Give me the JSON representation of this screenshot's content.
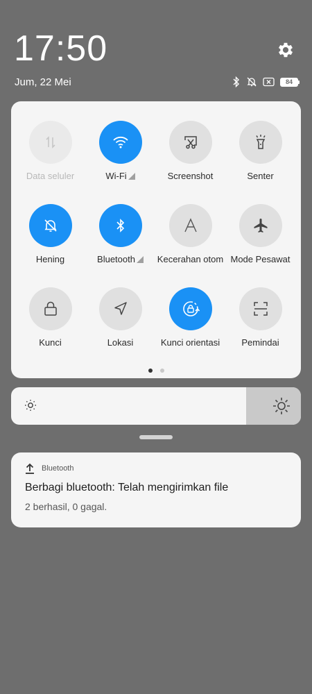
{
  "status": {
    "time": "17:50",
    "date": "Jum, 22 Mei",
    "battery": "84"
  },
  "quick_settings": {
    "tiles": [
      {
        "label": "Data seluler",
        "icon": "mobile-data-icon",
        "state": "disabled"
      },
      {
        "label": "Wi-Fi",
        "icon": "wifi-icon",
        "state": "on"
      },
      {
        "label": "Screenshot",
        "icon": "screenshot-icon",
        "state": "off"
      },
      {
        "label": "Senter",
        "icon": "flashlight-icon",
        "state": "off"
      },
      {
        "label": "Hening",
        "icon": "silent-bell-icon",
        "state": "on"
      },
      {
        "label": "Bluetooth",
        "icon": "bluetooth-icon",
        "state": "on"
      },
      {
        "label": "Kecerahan otom",
        "icon": "auto-brightness-icon",
        "state": "off"
      },
      {
        "label": "Mode Pesawat",
        "icon": "airplane-icon",
        "state": "off"
      },
      {
        "label": "Kunci",
        "icon": "lock-icon",
        "state": "off"
      },
      {
        "label": "Lokasi",
        "icon": "location-icon",
        "state": "off"
      },
      {
        "label": "Kunci orientasi",
        "icon": "rotation-lock-icon",
        "state": "on"
      },
      {
        "label": "Pemindai",
        "icon": "scanner-icon",
        "state": "off"
      }
    ],
    "page_indicator": {
      "pages": 2,
      "current": 1
    }
  },
  "brightness": {
    "level_fraction": 0.81
  },
  "notification": {
    "app": "Bluetooth",
    "title": "Berbagi bluetooth: Telah mengirimkan file",
    "text": "2 berhasil, 0 gagal."
  },
  "colors": {
    "background": "#6e6e6e",
    "panel": "#f5f5f5",
    "accent_on": "#1a91f5",
    "tile_off": "#e0e0e0"
  }
}
